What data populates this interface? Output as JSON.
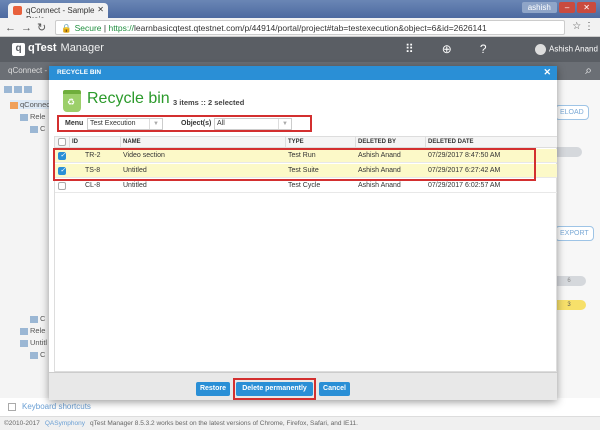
{
  "browser": {
    "tab_title": "qConnect - Sample Proje",
    "window_user": "ashish",
    "secure_label": "Secure",
    "url_scheme": "https://",
    "url_rest": "learnbasicqtest.qtestnet.com/p/44914/portal/project#tab=testexecution&object=6&id=2626141"
  },
  "app": {
    "logo": "qTest",
    "product": "Manager",
    "user": "Ashish Anand",
    "breadcrumb": "qConnect -"
  },
  "sidebar": {
    "items": [
      "qConnect",
      "Rele",
      "C",
      "",
      "C",
      "Rele",
      "Untitl",
      "C",
      ""
    ],
    "keyboard_shortcuts": "Keyboard shortcuts"
  },
  "background": {
    "reload": "ELOAD",
    "export": "EXPORT",
    "badge1": "6",
    "badge2": "3"
  },
  "footer": {
    "copyright": "©2010-2017",
    "company": "QASymphony",
    "note": "qTest Manager 8.5.3.2 works best on the latest versions of Chrome, Firefox, Safari, and IE11."
  },
  "modal": {
    "title": "RECYCLE BIN",
    "heading": "Recycle bin",
    "count": "3 items :: 2 selected",
    "menu_label": "Menu",
    "menu_value": "Test Execution",
    "objects_label": "Object(s)",
    "objects_value": "All",
    "columns": [
      "ID",
      "NAME",
      "TYPE",
      "DELETED BY",
      "DELETED DATE"
    ],
    "rows": [
      {
        "checked": true,
        "id": "TR-2",
        "name": "Video section",
        "type": "Test Run",
        "deleted_by": "Ashish Anand",
        "deleted_date": "07/29/2017 8:47:50 AM"
      },
      {
        "checked": true,
        "id": "TS-8",
        "name": "Untitled",
        "type": "Test Suite",
        "deleted_by": "Ashish Anand",
        "deleted_date": "07/29/2017 6:27:42 AM"
      },
      {
        "checked": false,
        "id": "CL-8",
        "name": "Untitled",
        "type": "Test Cycle",
        "deleted_by": "Ashish Anand",
        "deleted_date": "07/29/2017 6:02:57 AM"
      }
    ],
    "buttons": {
      "restore": "Restore",
      "delete": "Delete permanently",
      "cancel": "Cancel"
    }
  },
  "colors": {
    "accent": "#2a8fd6",
    "highlight": "#d32f2f",
    "selected_row": "#fcf9c8",
    "heading": "#2b9a2b"
  }
}
